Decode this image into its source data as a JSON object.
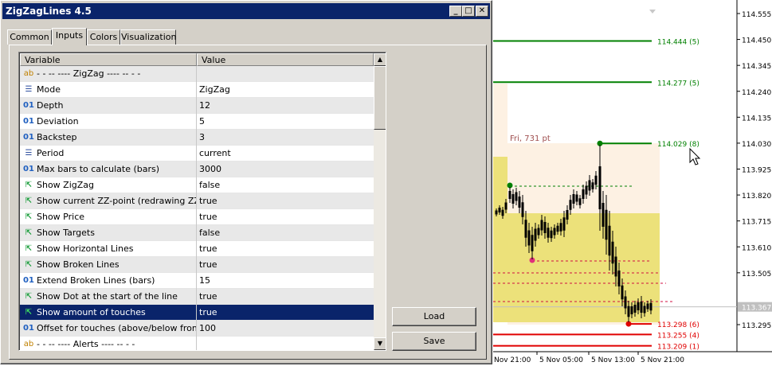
{
  "window": {
    "title": "ZigZagLines 4.5",
    "minimize": "_",
    "maximize": "□",
    "close": "✕"
  },
  "tabs": [
    {
      "label": "Common"
    },
    {
      "label": "Inputs"
    },
    {
      "label": "Colors"
    },
    {
      "label": "Visualization"
    }
  ],
  "grid": {
    "col_variable": "Variable",
    "col_value": "Value",
    "rows": [
      {
        "icon": "ab",
        "variable": "-     -     -- ---- ZigZag ---- --     -     -",
        "value": ""
      },
      {
        "icon": "enum",
        "variable": "Mode",
        "value": "ZigZag"
      },
      {
        "icon": "num",
        "variable": "Depth",
        "value": "12"
      },
      {
        "icon": "num",
        "variable": "Deviation",
        "value": "5"
      },
      {
        "icon": "num",
        "variable": "Backstep",
        "value": "3"
      },
      {
        "icon": "enum",
        "variable": "Period",
        "value": "current"
      },
      {
        "icon": "num",
        "variable": "Max bars to calculate (bars)",
        "value": "3000"
      },
      {
        "icon": "bool",
        "variable": "Show ZigZag",
        "value": "false"
      },
      {
        "icon": "bool",
        "variable": "Show current ZZ-point (redrawing ZZ-...",
        "value": "true"
      },
      {
        "icon": "bool",
        "variable": "Show Price",
        "value": "true"
      },
      {
        "icon": "bool",
        "variable": "Show Targets",
        "value": "false"
      },
      {
        "icon": "bool",
        "variable": "Show Horizontal Lines",
        "value": "true"
      },
      {
        "icon": "bool",
        "variable": "Show Broken Lines",
        "value": "true"
      },
      {
        "icon": "num",
        "variable": "Extend Broken Lines (bars)",
        "value": "15"
      },
      {
        "icon": "bool",
        "variable": "Show Dot at the start of the line",
        "value": "true"
      },
      {
        "icon": "bool",
        "variable": "Show amount of touches",
        "value": "true",
        "selected": true
      },
      {
        "icon": "num",
        "variable": "Offset for touches (above/below from...",
        "value": "100"
      },
      {
        "icon": "ab",
        "variable": "-     -     -- ---- Alerts ---- --     -     -",
        "value": ""
      }
    ]
  },
  "buttons": {
    "load": "Load",
    "save": "Save"
  },
  "chart": {
    "price_axis": [
      "114.555",
      "114.450",
      "114.345",
      "114.240",
      "114.135",
      "114.030",
      "113.925",
      "113.820",
      "113.715",
      "113.610",
      "113.505",
      "113.295"
    ],
    "current_price": "113.367",
    "time_axis": [
      "Nov 21:00",
      "5 Nov 05:00",
      "5 Nov 13:00",
      "5 Nov 21:00"
    ],
    "info_label": "Fri, 731 pt",
    "green_lines": [
      "114.444 (5)",
      "114.277 (5)",
      "114.029 (8)"
    ],
    "red_lines": [
      "113.298 (6)",
      "113.255 (4)",
      "113.209 (1)"
    ],
    "colors": {
      "resistance": "#008000",
      "support": "#e00000",
      "zone_light": "#fdf1e3",
      "zone_yellow": "#ece17a",
      "titlebar": "#0a246a",
      "dialog_bg": "#d4d0c8"
    },
    "cursor_icon": "mouse-pointer-icon"
  }
}
